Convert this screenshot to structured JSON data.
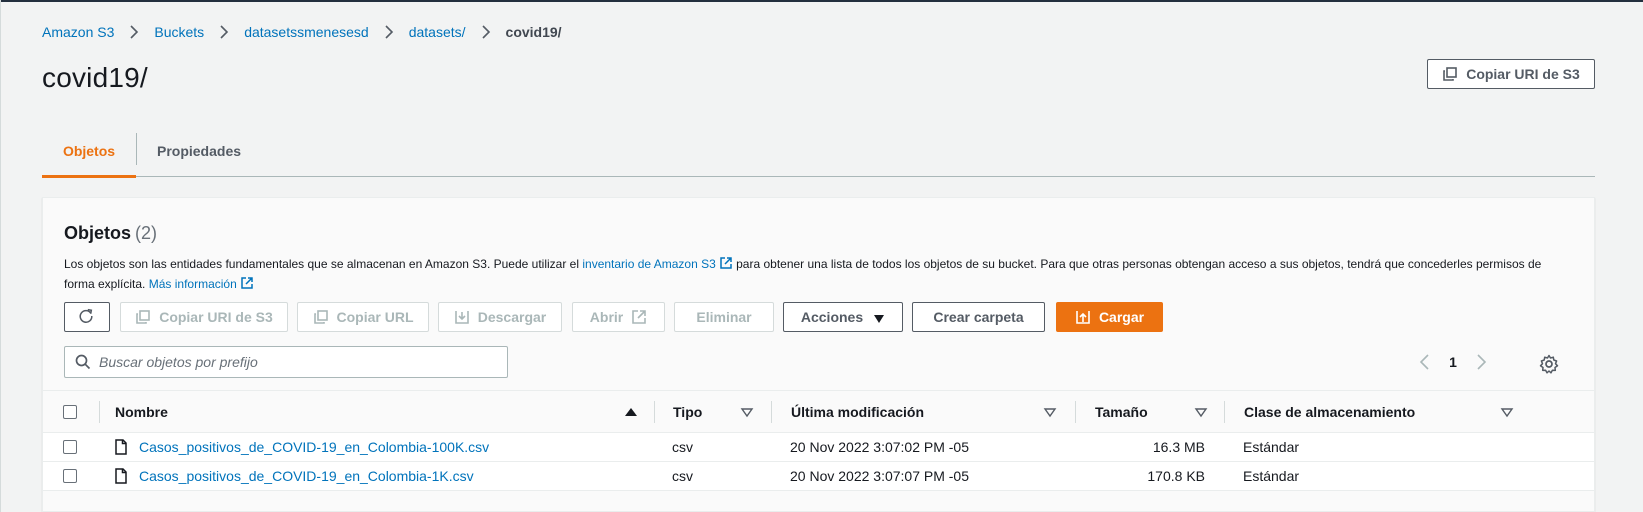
{
  "breadcrumb": {
    "items": [
      "Amazon S3",
      "Buckets",
      "datasetssmenesesd",
      "datasets/"
    ],
    "current": "covid19/"
  },
  "page": {
    "title": "covid19/",
    "copy_uri_label": "Copiar URI de S3"
  },
  "tabs": [
    {
      "label": "Objetos",
      "active": true
    },
    {
      "label": "Propiedades",
      "active": false
    }
  ],
  "objects": {
    "title": "Objetos",
    "count": "(2)",
    "description": {
      "part1": "Los objetos son las entidades fundamentales que se almacenan en Amazon S3. Puede utilizar el",
      "inventory_link": "inventario de Amazon S3",
      "part2": "para obtener una lista de todos los objetos de su bucket. Para que otras personas obtengan acceso a sus objetos, tendrá que concederles permisos de forma explícita.",
      "more_link": "Más información"
    },
    "toolbar": {
      "copy_uri": "Copiar URI de S3",
      "copy_url": "Copiar URL",
      "download": "Descargar",
      "open": "Abrir",
      "delete": "Eliminar",
      "actions": "Acciones",
      "create_folder": "Crear carpeta",
      "upload": "Cargar"
    },
    "search": {
      "placeholder": "Buscar objetos por prefijo"
    },
    "pagination": {
      "page": "1"
    },
    "columns": {
      "name": "Nombre",
      "type": "Tipo",
      "modified": "Última modificación",
      "size": "Tamaño",
      "storage_class": "Clase de almacenamiento"
    },
    "rows": [
      {
        "name": "Casos_positivos_de_COVID-19_en_Colombia-100K.csv",
        "type": "csv",
        "modified": "20 Nov 2022 3:07:02 PM -05",
        "size": "16.3 MB",
        "storage_class": "Estándar"
      },
      {
        "name": "Casos_positivos_de_COVID-19_en_Colombia-1K.csv",
        "type": "csv",
        "modified": "20 Nov 2022 3:07:07 PM -05",
        "size": "170.8 KB",
        "storage_class": "Estándar"
      }
    ]
  },
  "colors": {
    "accent": "#ec7211",
    "link": "#0073bb",
    "text": "#16191f",
    "muted": "#545b64",
    "disabled": "#aab7b8"
  }
}
